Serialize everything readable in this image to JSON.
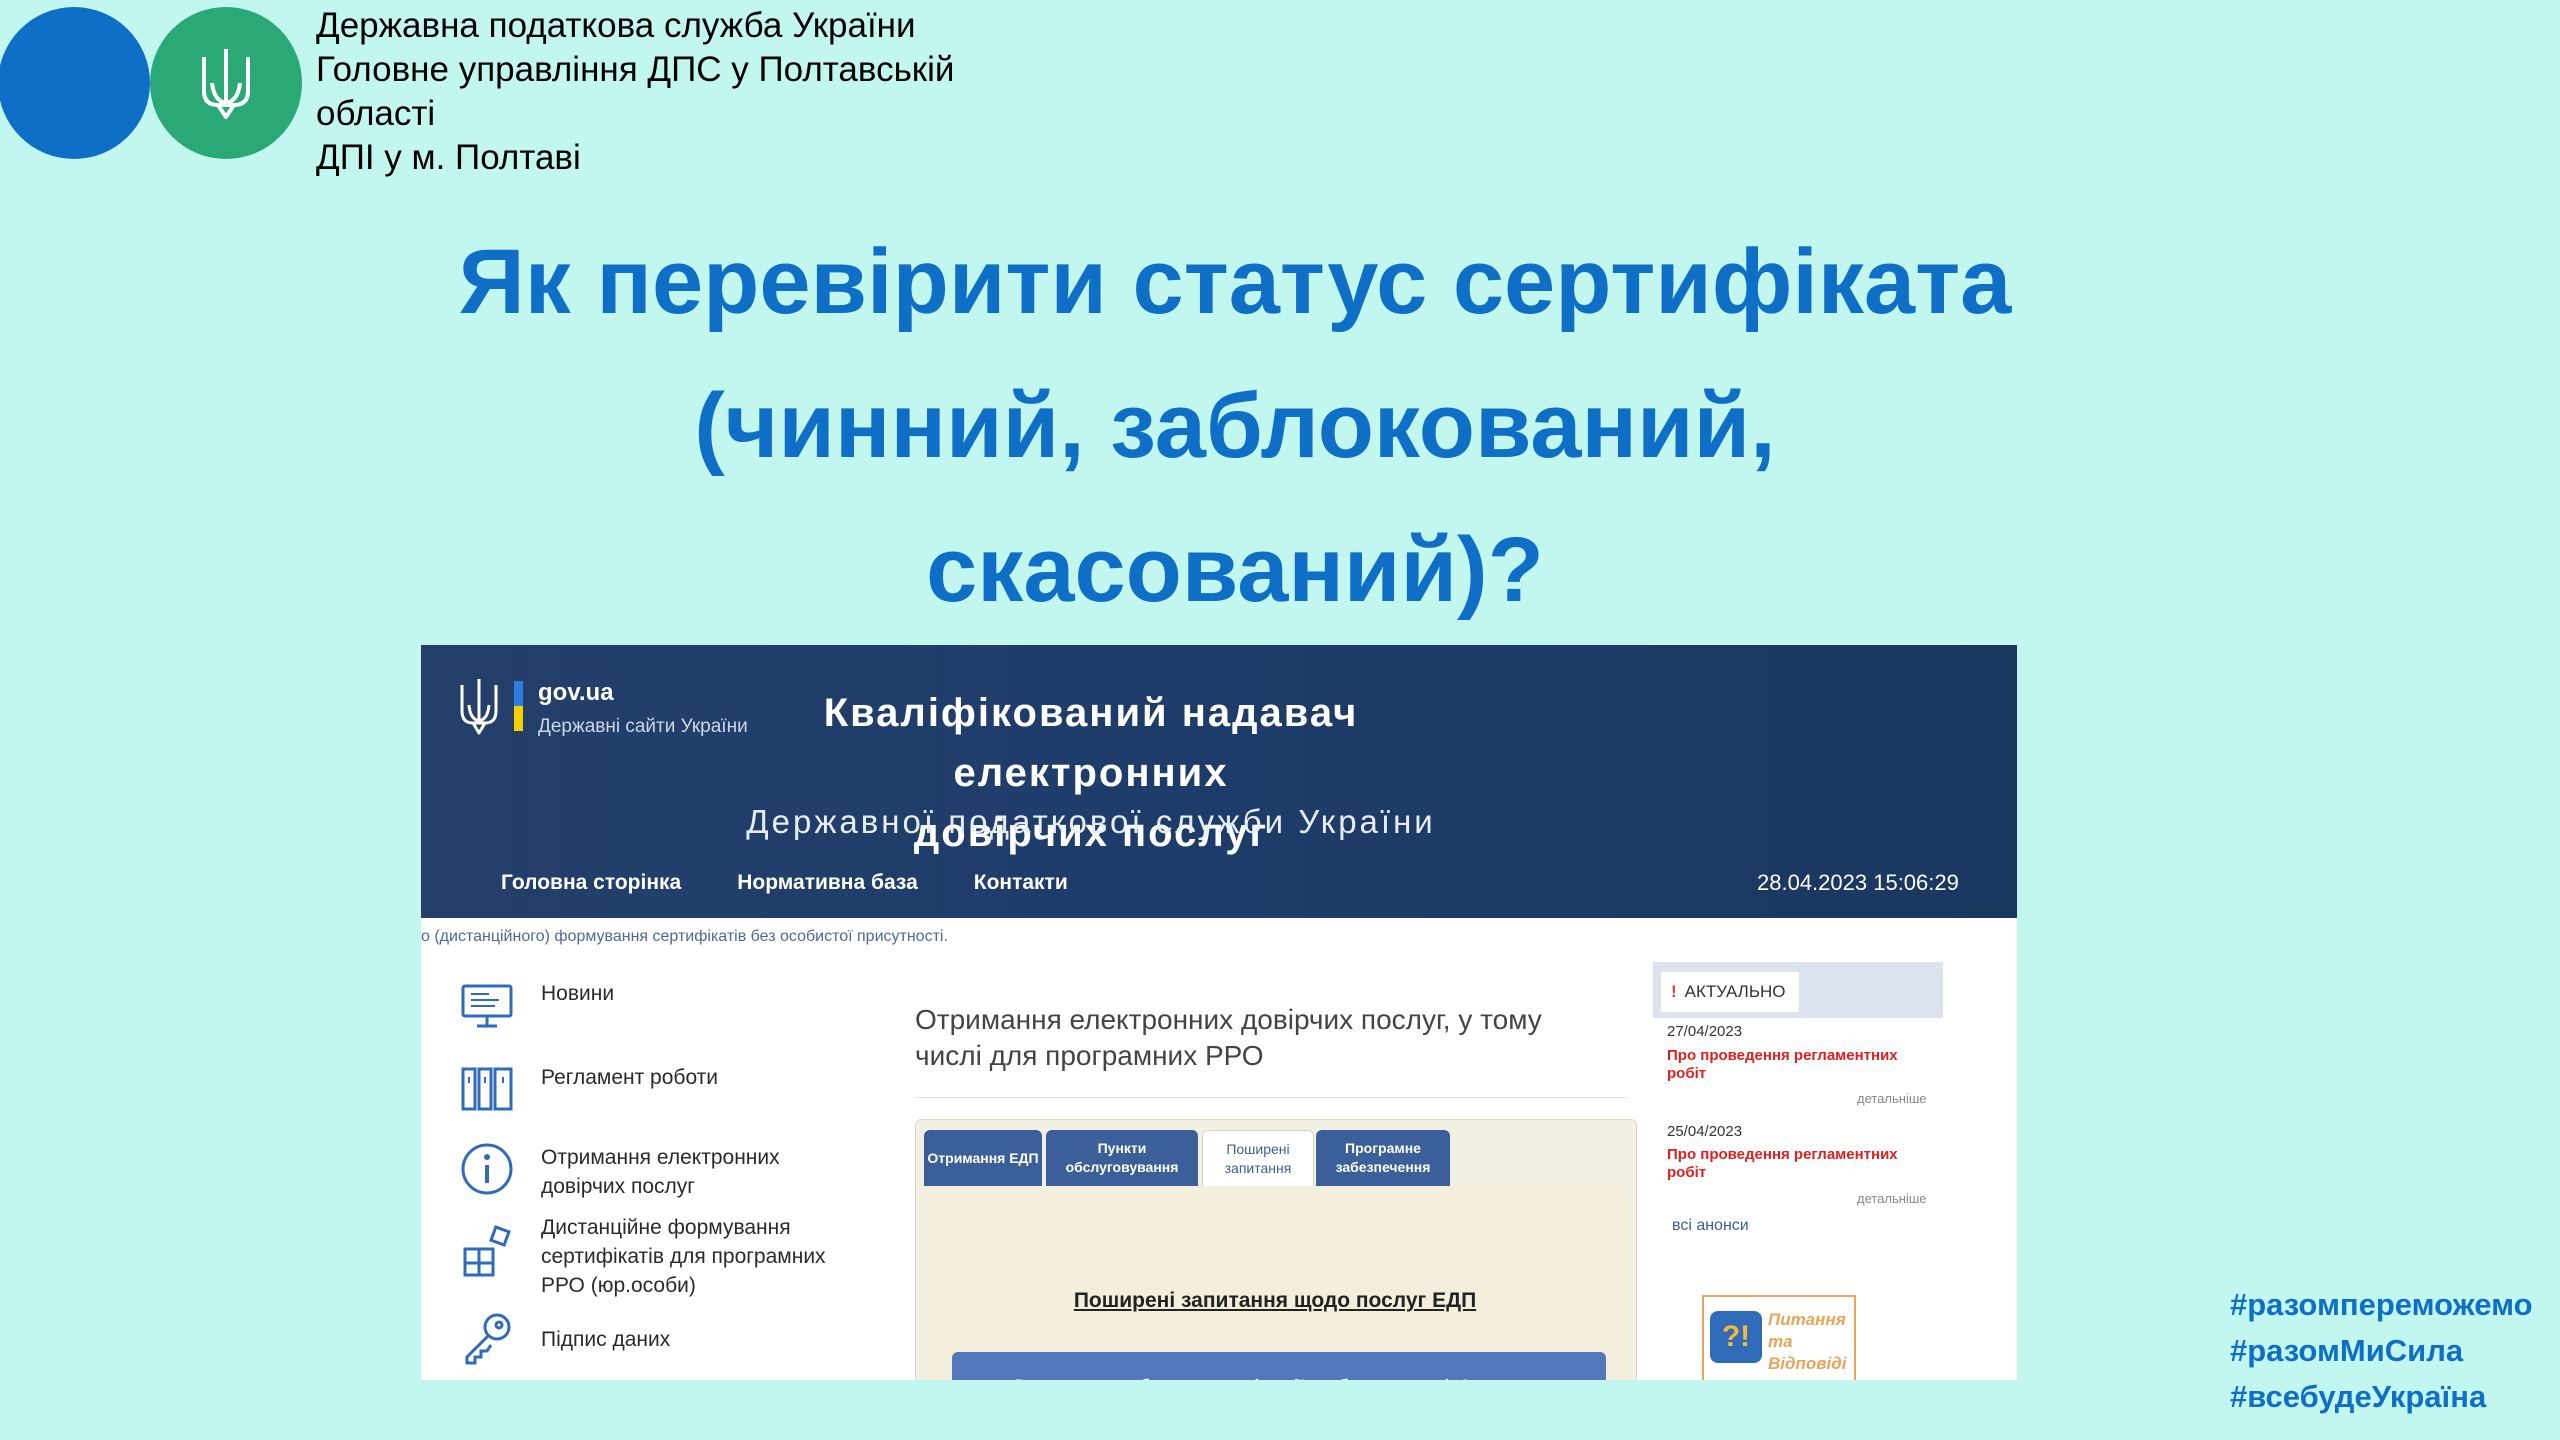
{
  "slide": {
    "org_lines": [
      "Державна податкова служба України",
      "Головне управління ДПС у Полтавській",
      "області",
      "ДПІ у м. Полтаві"
    ],
    "title_lines": [
      "Як перевірити статус сертифіката",
      "(чинний, заблокований,",
      "скасований)?"
    ],
    "hashtags": [
      "#разомпереможемо",
      "#разомМиСила",
      "#всебудеУкраїна"
    ],
    "colors": {
      "background": "#c2f7ef",
      "title": "#0f6fc6",
      "circle_blue": "#0f6fc6",
      "circle_green": "#2aa876"
    }
  },
  "site": {
    "gov_name": "gov.ua",
    "gov_sub": "Державні сайти України",
    "title_lines": [
      "Кваліфікований надавач електронних",
      "довірчих послуг"
    ],
    "subtitle": "Державної податкової служби України",
    "nav": [
      "Головна сторінка",
      "Нормативна база",
      "Контакти"
    ],
    "datetime": "28.04.2023 15:06:29",
    "ticker": "о (дистанційного) формування сертифікатів без особистої присутності.",
    "sidebar": [
      {
        "icon": "monitor-icon",
        "label": "Новини"
      },
      {
        "icon": "binders-icon",
        "label": "Регламент роботи"
      },
      {
        "icon": "info-icon",
        "label": "Отримання електронних довірчих послуг"
      },
      {
        "icon": "blocks-icon",
        "label": "Дистанційне формування сертифікатів для програмних РРО (юр.особи)"
      },
      {
        "icon": "key-icon",
        "label": "Підпис даних"
      }
    ],
    "main_heading": "Отримання електронних довірчих послуг, у тому числі для програмних РРО",
    "tabs": [
      "Отримання ЕДП",
      "Пункти обслуговування",
      "Поширені запитання",
      "Програмне забезпечення"
    ],
    "faq_title": "Поширені запитання щодо послуг ЕДП",
    "faq_item": "Де можна придбати захищені носії особистих ключів?",
    "aktual": {
      "mark": "!",
      "label": "АКТУАЛЬНО",
      "news": [
        {
          "date": "27/04/2023",
          "title": "Про проведення регламентних робіт",
          "more": "детальніше"
        },
        {
          "date": "25/04/2023",
          "title": "Про проведення регламентних робіт",
          "more": "детальніше"
        }
      ],
      "all": "всі анонси"
    },
    "qa": {
      "icon_text": "?!",
      "label": "Питання та Відповіді"
    }
  }
}
